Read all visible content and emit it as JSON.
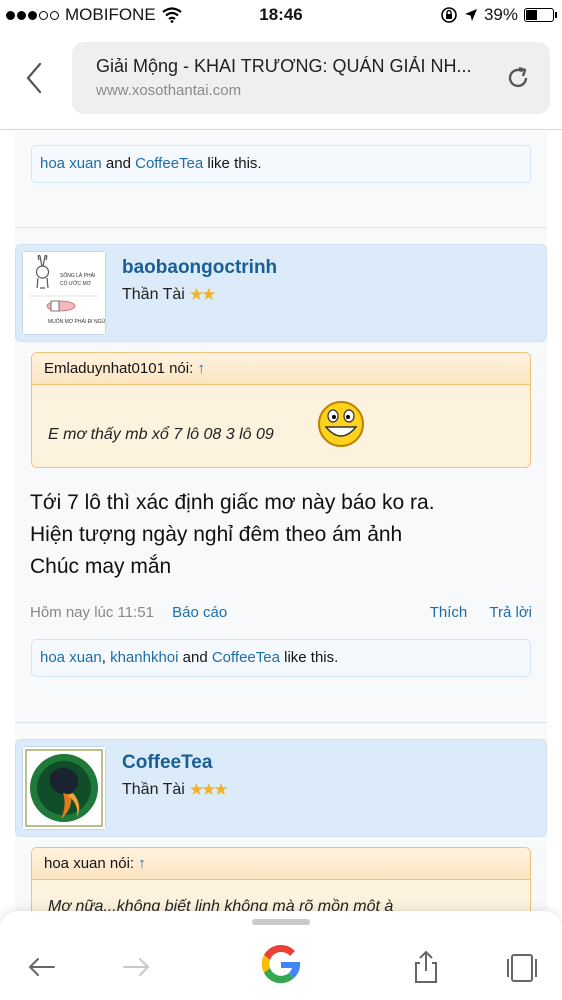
{
  "status_bar": {
    "carrier": "MOBIFONE",
    "time": "18:46",
    "battery": "39%"
  },
  "browser": {
    "page_title": "Giải Mộng - KHAI TRƯƠNG: QUÁN GIẢI NH...",
    "url": "www.xosothantai.com"
  },
  "posts": [
    {
      "likes": {
        "users": [
          "hoa xuan",
          "CoffeeTea"
        ],
        "suffix": "like this.",
        "joiner": "and"
      }
    },
    {
      "username": "baobaongoctrinh",
      "rank": "Thần Tài",
      "stars": 2,
      "avatar_text": [
        "SỐNG LÀ PHẢI",
        "CÓ ƯỚC MƠ",
        "MUỐN MƠ PHẢI ĐI NGỦ"
      ],
      "quote": {
        "author": "Emladuynhat0101 nói:",
        "arrow": "↑",
        "text": "E mơ thấy mb xổ 7 lô 08 3 lô 09"
      },
      "message": [
        "Tới 7 lô thì xác định giấc mơ này báo ko ra.",
        "Hiện tượng ngày nghỉ đêm theo ám ảnh",
        "Chúc may mắn"
      ],
      "date": "Hôm nay lúc 11:51",
      "report": "Báo cáo",
      "like_action": "Thích",
      "reply_action": "Trả lời",
      "likes": {
        "user1": "hoa xuan",
        "comma": ",",
        "user2": "khanhkhoi",
        "joiner": "and",
        "user3": "CoffeeTea",
        "suffix": "like this."
      }
    },
    {
      "username": "CoffeeTea",
      "rank": "Thần Tài",
      "stars": 3,
      "quote": {
        "author": "hoa xuan nói:",
        "arrow": "↑",
        "text": "Mơ nữa...không biết linh không mà rõ mồn một à"
      }
    }
  ],
  "icons": {
    "back": "chevron-left-icon",
    "reload": "reload-icon",
    "toolbar": [
      "back-arrow-icon",
      "forward-arrow-icon",
      "google-icon",
      "share-icon",
      "tabs-icon"
    ]
  },
  "colors": {
    "link": "#1d6ea8",
    "userbar": "#dcebf9",
    "quote_bg": "#fdf2de",
    "star": "#f1b22a"
  }
}
